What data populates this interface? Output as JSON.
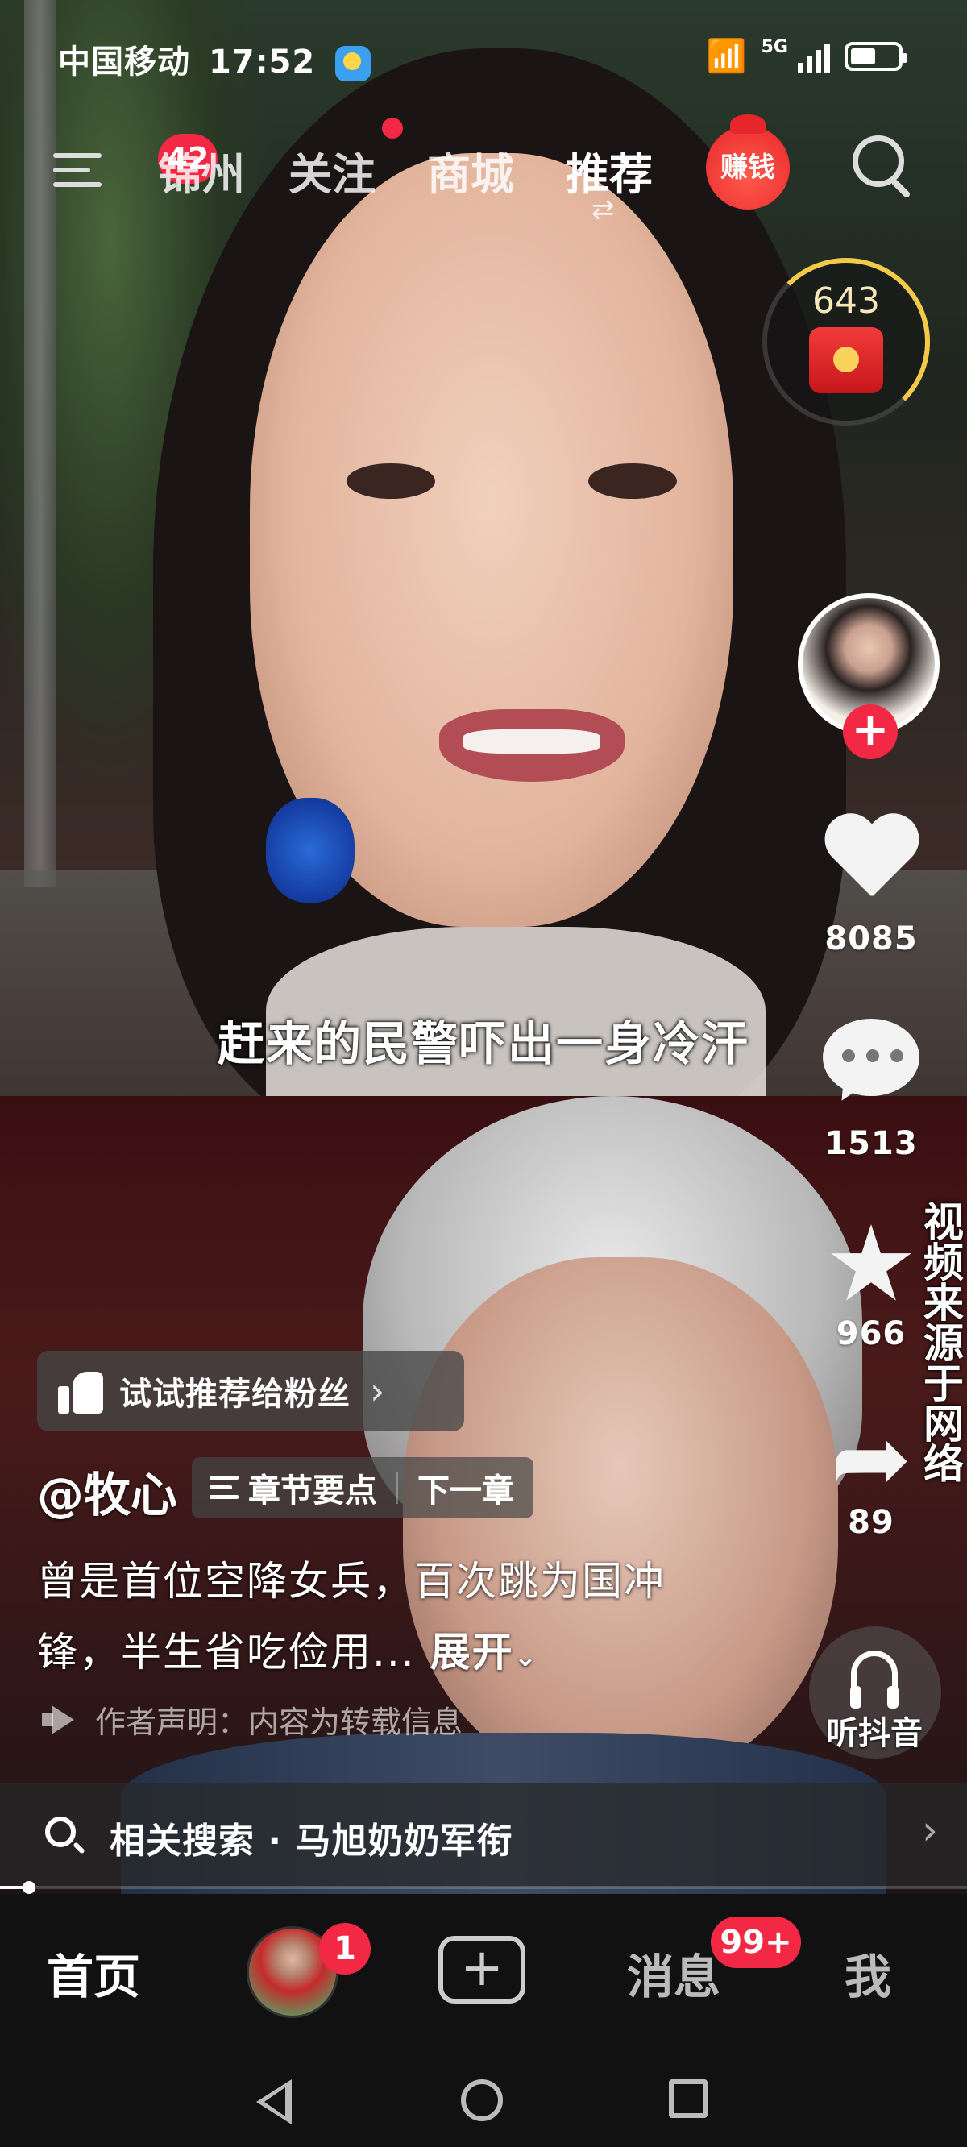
{
  "status_bar": {
    "carrier": "中国移动",
    "time": "17:52",
    "network": "5G"
  },
  "top_nav": {
    "menu_badge": "42",
    "tabs": [
      "锦州",
      "关注",
      "商城",
      "推荐"
    ],
    "earn_label": "赚钱"
  },
  "coin_widget": {
    "count": "643"
  },
  "right_rail": {
    "likes": "8085",
    "comments": "1513",
    "favorites": "966",
    "shares": "89",
    "listen_label": "听抖音"
  },
  "watermark": "视频来源于网络",
  "video": {
    "caption": "赶来的民警吓出一身冷汗"
  },
  "info": {
    "recommend_label": "试试推荐给粉丝",
    "author": "@牧心",
    "chapter_summary": "章节要点",
    "next_chapter": "下一章",
    "description": "曾是首位空降女兵，百次跳为国冲锋，半生省吃俭用...",
    "expand_label": "展开",
    "disclaimer": "作者声明：内容为转载信息",
    "related_search": "相关搜索 · 马旭奶奶军衔"
  },
  "progress": {
    "value": 0.03
  },
  "tab_bar": {
    "home": "首页",
    "friends_badge": "1",
    "messages": "消息",
    "messages_badge": "99+",
    "me": "我"
  }
}
